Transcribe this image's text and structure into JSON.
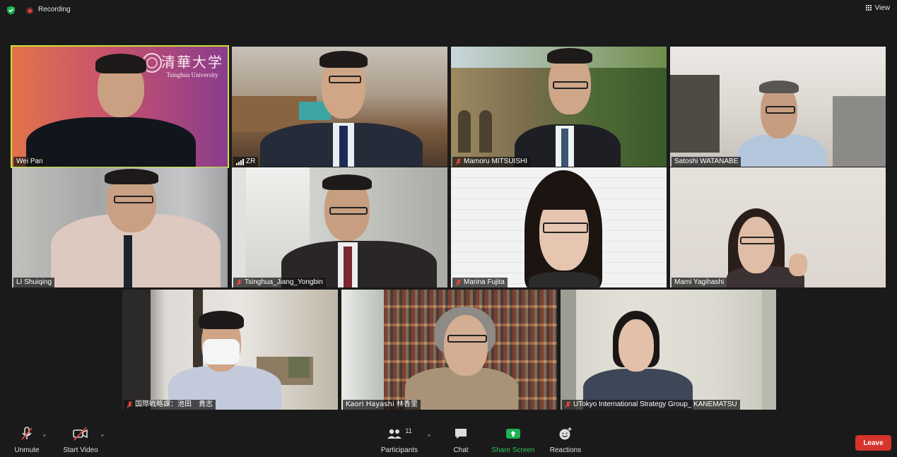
{
  "top": {
    "recording_label": "Recording",
    "view_label": "View"
  },
  "participants": [
    {
      "name": "Wei Pan",
      "active": true
    },
    {
      "name": "ZR"
    },
    {
      "name": "Mamoru MITSUISHI",
      "muted": true
    },
    {
      "name": "Satoshi WATANABE"
    },
    {
      "name": "LI Shuiqing"
    },
    {
      "name": "Tsinghua_Jiang_Yongbin",
      "muted": true
    },
    {
      "name": "Marina Fujita",
      "muted": true
    },
    {
      "name": "Mami Yagihashi"
    },
    {
      "name": "国際戦略課：池田　貴志",
      "muted": true
    },
    {
      "name": "Kaori Hayashi 林香里"
    },
    {
      "name": "UTokyo International Strategy Group_ KANEMATSU",
      "muted": true
    }
  ],
  "banner": {
    "chinese": "清華大学",
    "english": "Tsinghua University"
  },
  "toolbar": {
    "unmute_label": "Unmute",
    "start_video_label": "Start Video",
    "participants_label": "Participants",
    "participants_count": "11",
    "chat_label": "Chat",
    "share_screen_label": "Share Screen",
    "reactions_label": "Reactions",
    "leave_label": "Leave"
  },
  "colors": {
    "active_border": "#c6e33a",
    "leave": "#d6342c",
    "share_green": "#1fb154",
    "muted_red": "#e5483f"
  }
}
